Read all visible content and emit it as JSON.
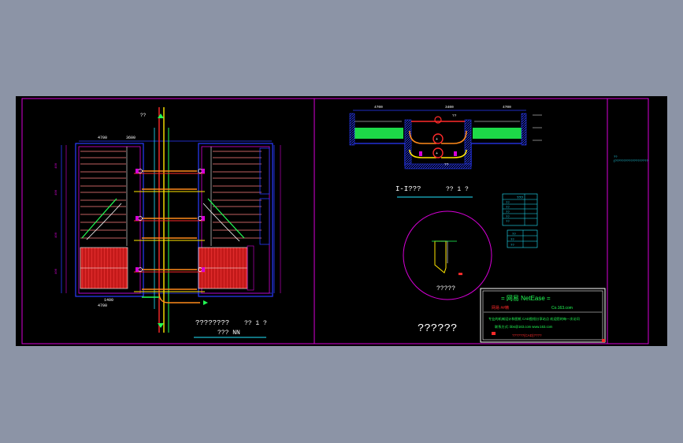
{
  "drawing": {
    "plan_top_label": "??",
    "plan_dim_top": "4700",
    "plan_dim_top_right": "3600",
    "plan_dim_bottom_left": "1400",
    "plan_dim_bottom": "4700",
    "plan_title": "????????",
    "plan_scale": "?? 1 ?",
    "plan_subtitle": "??? NN",
    "section_title": "I-I???",
    "section_scale": "?? 1 ?",
    "section_dim_left": "4700",
    "section_dim_mid": "3400",
    "section_dim_right": "4700",
    "section_label_mid": "??",
    "section_label_pump": "??",
    "detail_label": "?????",
    "big_title": "??????",
    "notes_text": "??(?????????????????????????????????????????????????????????????)",
    "table_header": "???",
    "table_rows": [
      "??",
      "??",
      "??",
      "??",
      "??",
      "??"
    ],
    "table2_header": "??",
    "table2_rows": [
      "??",
      "??",
      "??"
    ],
    "title_block": {
      "brand": "= 网易 NetEase =",
      "line2_left": "网易 ##精",
      "line2_right": "Co.163.com",
      "line3": "专业的机械设计和图纸 CAD图纸分享站点 欢迎您的每一次访问",
      "line4": "联系方式: bbs@163.com  www.163.com",
      "line5": "??????(CAD)????"
    }
  },
  "colors": {
    "magenta": "#d800d8",
    "blue": "#2a3bff",
    "red": "#ff2a2a",
    "yellow": "#ffe600",
    "green": "#22ff55",
    "cyan": "#22e6ff",
    "orange": "#ff8a1a",
    "white": "#ffffff"
  }
}
